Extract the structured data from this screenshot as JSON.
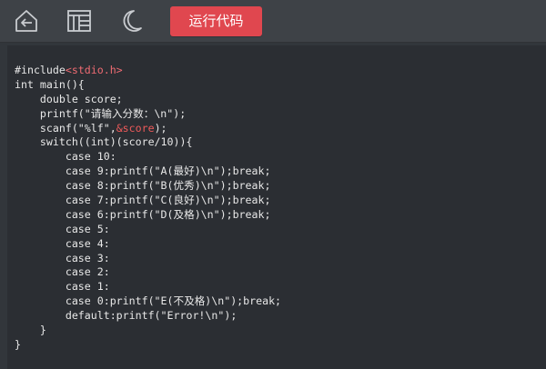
{
  "toolbar": {
    "icons": {
      "back": "back-arrow-icon",
      "layout": "layout-grid-icon",
      "theme": "moon-icon"
    },
    "run_label": "运行代码",
    "run_color": "#e0474f"
  },
  "editor": {
    "lines": [
      {
        "parts": [
          "#include",
          "<stdio.h>"
        ]
      },
      {
        "text": "int main(){"
      },
      {
        "text": "    double score;"
      },
      {
        "text": "    printf(\"请输入分数：\\n\");"
      },
      {
        "parts": [
          "    scanf(\"%lf\",",
          "&score",
          ");"
        ]
      },
      {
        "text": "    switch((int)(score/10)){"
      },
      {
        "text": "        case 10:"
      },
      {
        "text": "        case 9:printf(\"A(最好)\\n\");break;"
      },
      {
        "text": "        case 8:printf(\"B(优秀)\\n\");break;"
      },
      {
        "text": "        case 7:printf(\"C(良好)\\n\");break;"
      },
      {
        "text": "        case 6:printf(\"D(及格)\\n\");break;"
      },
      {
        "text": "        case 5:"
      },
      {
        "text": "        case 4:"
      },
      {
        "text": "        case 3:"
      },
      {
        "text": "        case 2:"
      },
      {
        "text": "        case 1:"
      },
      {
        "text": "        case 0:printf(\"E(不及格)\\n\");break;"
      },
      {
        "text": "        default:printf(\"Error!\\n\");"
      },
      {
        "text": "    }"
      },
      {
        "text": "}"
      }
    ]
  }
}
